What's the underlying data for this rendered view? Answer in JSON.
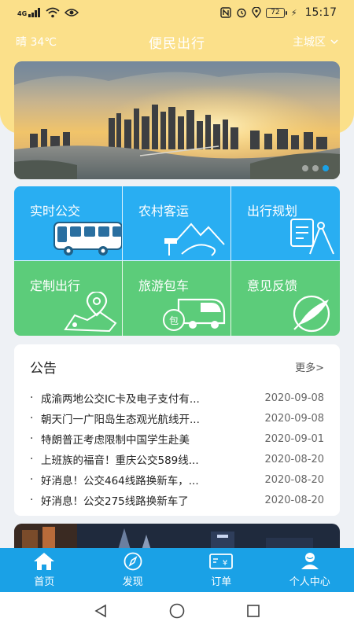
{
  "status_bar": {
    "signal_label": "4G",
    "battery": "72",
    "time": "15:17"
  },
  "header": {
    "weather": "晴 34℃",
    "title": "便民出行",
    "district": "主城区"
  },
  "banner": {
    "slides": 3,
    "active_slide": 3
  },
  "services": [
    {
      "label": "实时公交",
      "icon": "bus-icon",
      "color": "#29aef2"
    },
    {
      "label": "农村客运",
      "icon": "mountain-road-icon",
      "color": "#29aef2"
    },
    {
      "label": "出行规划",
      "icon": "plan-compass-icon",
      "color": "#29aef2"
    },
    {
      "label": "定制出行",
      "icon": "map-pin-icon",
      "color": "#5ccc7a"
    },
    {
      "label": "旅游包车",
      "icon": "charter-bus-icon",
      "color": "#5ccc7a"
    },
    {
      "label": "意见反馈",
      "icon": "feedback-pen-icon",
      "color": "#5ccc7a"
    }
  ],
  "notice": {
    "title": "公告",
    "more": "更多>",
    "items": [
      {
        "text": "成渝两地公交IC卡及电子支付有...",
        "date": "2020-09-08"
      },
      {
        "text": "朝天门一广阳岛生态观光航线开...",
        "date": "2020-09-08"
      },
      {
        "text": "特朗普正考虑限制中国学生赴美",
        "date": "2020-09-01"
      },
      {
        "text": "上班族的福音！重庆公交589线...",
        "date": "2020-08-20"
      },
      {
        "text": "好消息！公交464线路换新车，...",
        "date": "2020-08-20"
      },
      {
        "text": "好消息！公交275线路换新车了",
        "date": "2020-08-20"
      }
    ]
  },
  "tabbar": {
    "items": [
      {
        "label": "首页",
        "icon": "home-icon"
      },
      {
        "label": "发现",
        "icon": "compass-icon"
      },
      {
        "label": "订单",
        "icon": "order-ticket-icon"
      },
      {
        "label": "个人中心",
        "icon": "user-icon"
      }
    ]
  },
  "colors": {
    "header": "#fbe08a",
    "primary": "#1aa1e6",
    "tile_blue": "#29aef2",
    "tile_green": "#5ccc7a"
  }
}
